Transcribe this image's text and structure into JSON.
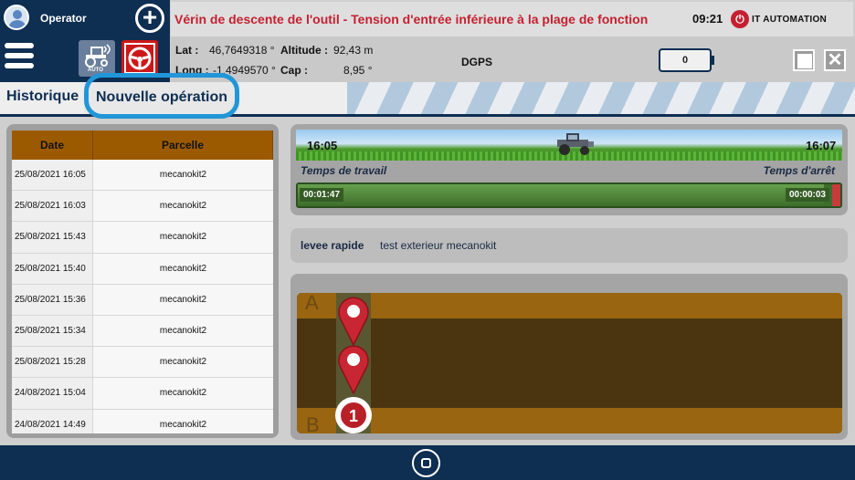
{
  "header": {
    "operator": "Operator",
    "alarm": "Vérin de descente de l'outil  -  Tension d'entrée inférieure à la plage de fonction",
    "clock": "09:21",
    "brand": "IT AUTOMATION",
    "auto_label": "AUTO"
  },
  "gps": {
    "lat_label": "Lat :",
    "lat_value": "46,7649318 °",
    "long_label": "Long :",
    "long_value": "-1,4949570 °",
    "altitude_label": "Altitude :",
    "altitude_value": "92,43 m",
    "cap_label": "Cap :",
    "cap_value": "8,95 °",
    "mode": "DGPS",
    "counter": "0"
  },
  "tabs": [
    {
      "label": "Historique"
    },
    {
      "label": "Nouvelle opération"
    }
  ],
  "history": {
    "headers": {
      "date": "Date",
      "parcelle": "Parcelle"
    },
    "rows": [
      {
        "date": "25/08/2021 16:05",
        "parcelle": "mecanokit2"
      },
      {
        "date": "25/08/2021 16:03",
        "parcelle": "mecanokit2"
      },
      {
        "date": "25/08/2021 15:43",
        "parcelle": "mecanokit2"
      },
      {
        "date": "25/08/2021 15:40",
        "parcelle": "mecanokit2"
      },
      {
        "date": "25/08/2021 15:36",
        "parcelle": "mecanokit2"
      },
      {
        "date": "25/08/2021 15:34",
        "parcelle": "mecanokit2"
      },
      {
        "date": "25/08/2021 15:28",
        "parcelle": "mecanokit2"
      },
      {
        "date": "24/08/2021 15:04",
        "parcelle": "mecanokit2"
      },
      {
        "date": "24/08/2021 14:49",
        "parcelle": "mecanokit2"
      }
    ]
  },
  "timing": {
    "start": "16:05",
    "end": "16:07",
    "work_label": "Temps de travail",
    "stop_label": "Temps d'arrêt",
    "work_value": "00:01:47",
    "stop_value": "00:00:03",
    "work_fraction": 0.97,
    "stop_fraction": 0.03
  },
  "operation": {
    "name": "levee rapide",
    "description": "test exterieur mecanokit"
  },
  "map": {
    "label_a": "A",
    "label_b": "B",
    "current_marker": "1"
  },
  "colors": {
    "navy": "#0e2e52",
    "alarm_red": "#c42030",
    "header_brown": "#9c5a00",
    "highlight_blue": "#2196d8",
    "field_band": "#9a6510",
    "field_dark": "#4a3510"
  },
  "icons": {
    "user": "user-avatar-icon",
    "add": "plus-circle-icon",
    "menu": "hamburger-menu-icon",
    "tractor": "tractor-auto-icon",
    "steering": "steering-wheel-icon",
    "layout": "grid-layout-icon",
    "close": "close-icon",
    "home": "home-circle-icon",
    "pin": "map-pin-icon"
  }
}
